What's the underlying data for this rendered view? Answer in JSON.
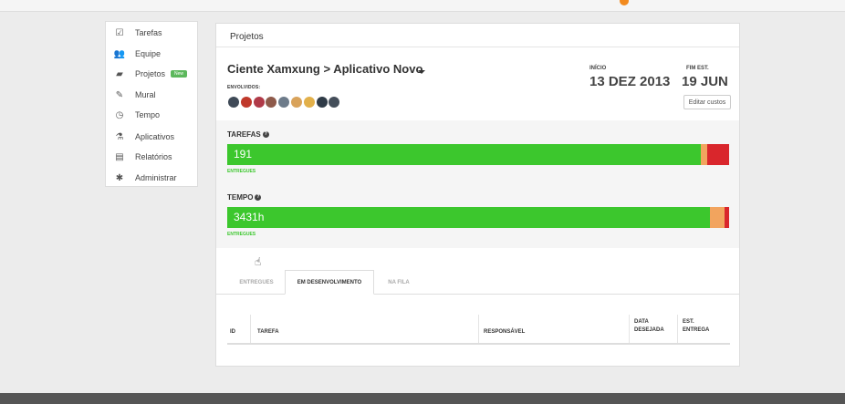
{
  "sidebar": {
    "items": [
      {
        "label": "Tarefas",
        "icon": "check-square-icon",
        "glyph": "☑"
      },
      {
        "label": "Equipe",
        "icon": "users-icon",
        "glyph": "👥"
      },
      {
        "label": "Projetos",
        "icon": "folder-open-icon",
        "glyph": "▰",
        "badge": "New"
      },
      {
        "label": "Mural",
        "icon": "pin-icon",
        "glyph": "✎"
      },
      {
        "label": "Tempo",
        "icon": "clock-icon",
        "glyph": "◷"
      },
      {
        "label": "Aplicativos",
        "icon": "flask-icon",
        "glyph": "⚗"
      },
      {
        "label": "Relatórios",
        "icon": "document-icon",
        "glyph": "▤"
      },
      {
        "label": "Administrar",
        "icon": "gear-icon",
        "glyph": "✱"
      }
    ]
  },
  "card": {
    "header": "Projetos",
    "project_title": "Ciente Xamxung > Aplicativo Novo",
    "involved_label": "ENVOLVIDOS:",
    "start": {
      "label": "INÍCIO",
      "value": "13 DEZ 2013"
    },
    "end": {
      "label": "FIM EST.",
      "value": "19 JUN"
    },
    "edit_costs": "Editar custos",
    "avatar_colors": [
      "#3f4a57",
      "#c0392b",
      "#b03a48",
      "#8e5a4a",
      "#6d7b8a",
      "#d9a35b",
      "#e2b04a",
      "#2f3b47",
      "#444e5a"
    ]
  },
  "metrics": {
    "tasks": {
      "label": "TAREFAS",
      "value": "191",
      "sub": "ENTREGUES",
      "delivered_fraction": 0.943,
      "warning_fraction": 0.014,
      "late_fraction": 0.043
    },
    "time": {
      "label": "TEMPO",
      "value": "3431h",
      "sub": "ENTREGUES",
      "delivered_fraction": 0.962,
      "warning_fraction": 0.029,
      "late_fraction": 0.009
    }
  },
  "tabs": [
    "ENTREGUES",
    "EM DESENVOLVIMENTO",
    "NA FILA"
  ],
  "active_tab": "EM DESENVOLVIMENTO",
  "table": {
    "columns": [
      "ID",
      "TAREFA",
      "RESPONSÁVEL",
      "DATA DESEJADA",
      "EST. ENTREGA"
    ],
    "rows": []
  },
  "colors": {
    "delivered": "#3cc72d",
    "warning": "#f2a45e",
    "late": "#d9262c",
    "badge": "#5cb85c"
  }
}
